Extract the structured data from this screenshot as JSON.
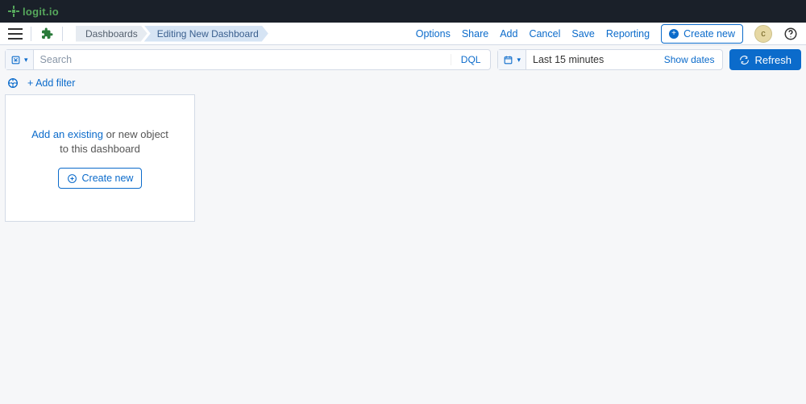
{
  "brand": {
    "name": "logit.io"
  },
  "header": {
    "breadcrumbs": [
      "Dashboards",
      "Editing New Dashboard"
    ],
    "actions": {
      "options": "Options",
      "share": "Share",
      "add": "Add",
      "cancel": "Cancel",
      "save": "Save",
      "reporting": "Reporting",
      "create_new": "Create new"
    },
    "avatar_initial": "c"
  },
  "query": {
    "search_placeholder": "Search",
    "language_label": "DQL",
    "time_range": "Last 15 minutes",
    "show_dates_label": "Show dates",
    "refresh_label": "Refresh"
  },
  "filters": {
    "add_filter_label": "+ Add filter"
  },
  "placeholder_panel": {
    "link_text": "Add an existing",
    "rest_text_line1": " or new object",
    "rest_text_line2": "to this dashboard",
    "create_new_label": "Create new"
  }
}
